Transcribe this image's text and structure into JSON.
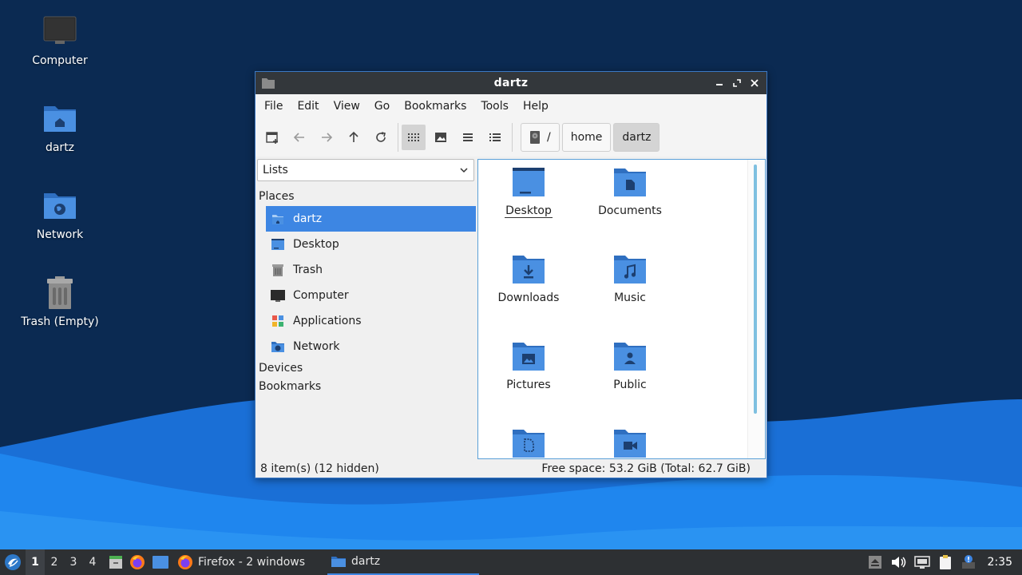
{
  "desktop": {
    "icons": [
      {
        "label": "Computer"
      },
      {
        "label": "dartz"
      },
      {
        "label": "Network"
      },
      {
        "label": "Trash (Empty)"
      }
    ]
  },
  "window": {
    "title": "dartz",
    "controls": {
      "minimize": "–",
      "restore": "⤢",
      "close": "✕"
    },
    "menu": [
      "File",
      "Edit",
      "View",
      "Go",
      "Bookmarks",
      "Tools",
      "Help"
    ],
    "breadcrumb": [
      {
        "label": "/"
      },
      {
        "label": "home"
      },
      {
        "label": "dartz"
      }
    ],
    "sidebar": {
      "mode": "Lists",
      "places_header": "Places",
      "places": [
        {
          "label": "dartz",
          "icon": "home-folder-icon",
          "selected": true
        },
        {
          "label": "Desktop",
          "icon": "desktop-icon"
        },
        {
          "label": "Trash",
          "icon": "trash-icon"
        },
        {
          "label": "Computer",
          "icon": "computer-icon"
        },
        {
          "label": "Applications",
          "icon": "applications-icon"
        },
        {
          "label": "Network",
          "icon": "network-icon"
        }
      ],
      "devices_header": "Devices",
      "bookmarks_header": "Bookmarks"
    },
    "files": [
      {
        "label": "Desktop",
        "icon": "desktop-folder-icon"
      },
      {
        "label": "Documents",
        "icon": "documents-folder-icon"
      },
      {
        "label": "Downloads",
        "icon": "downloads-folder-icon"
      },
      {
        "label": "Music",
        "icon": "music-folder-icon"
      },
      {
        "label": "Pictures",
        "icon": "pictures-folder-icon"
      },
      {
        "label": "Public",
        "icon": "public-folder-icon"
      },
      {
        "label": "",
        "icon": "templates-folder-icon"
      },
      {
        "label": "",
        "icon": "videos-folder-icon"
      }
    ],
    "status_left": "8 item(s) (12 hidden)",
    "status_right": "Free space: 53.2 GiB (Total: 62.7 GiB)"
  },
  "taskbar": {
    "workspaces": [
      "1",
      "2",
      "3",
      "4"
    ],
    "active_workspace": "1",
    "tasks": [
      {
        "label": "Firefox - 2 windows",
        "icon": "firefox-icon"
      },
      {
        "label": "dartz",
        "icon": "folder-icon",
        "active": true
      }
    ],
    "clock": "2:35"
  },
  "colors": {
    "accent": "#3d86e3",
    "folder": "#4a90e2",
    "folder_dark": "#2f6fc0",
    "titlebar": "#33373b",
    "taskbar": "#2d3033"
  }
}
